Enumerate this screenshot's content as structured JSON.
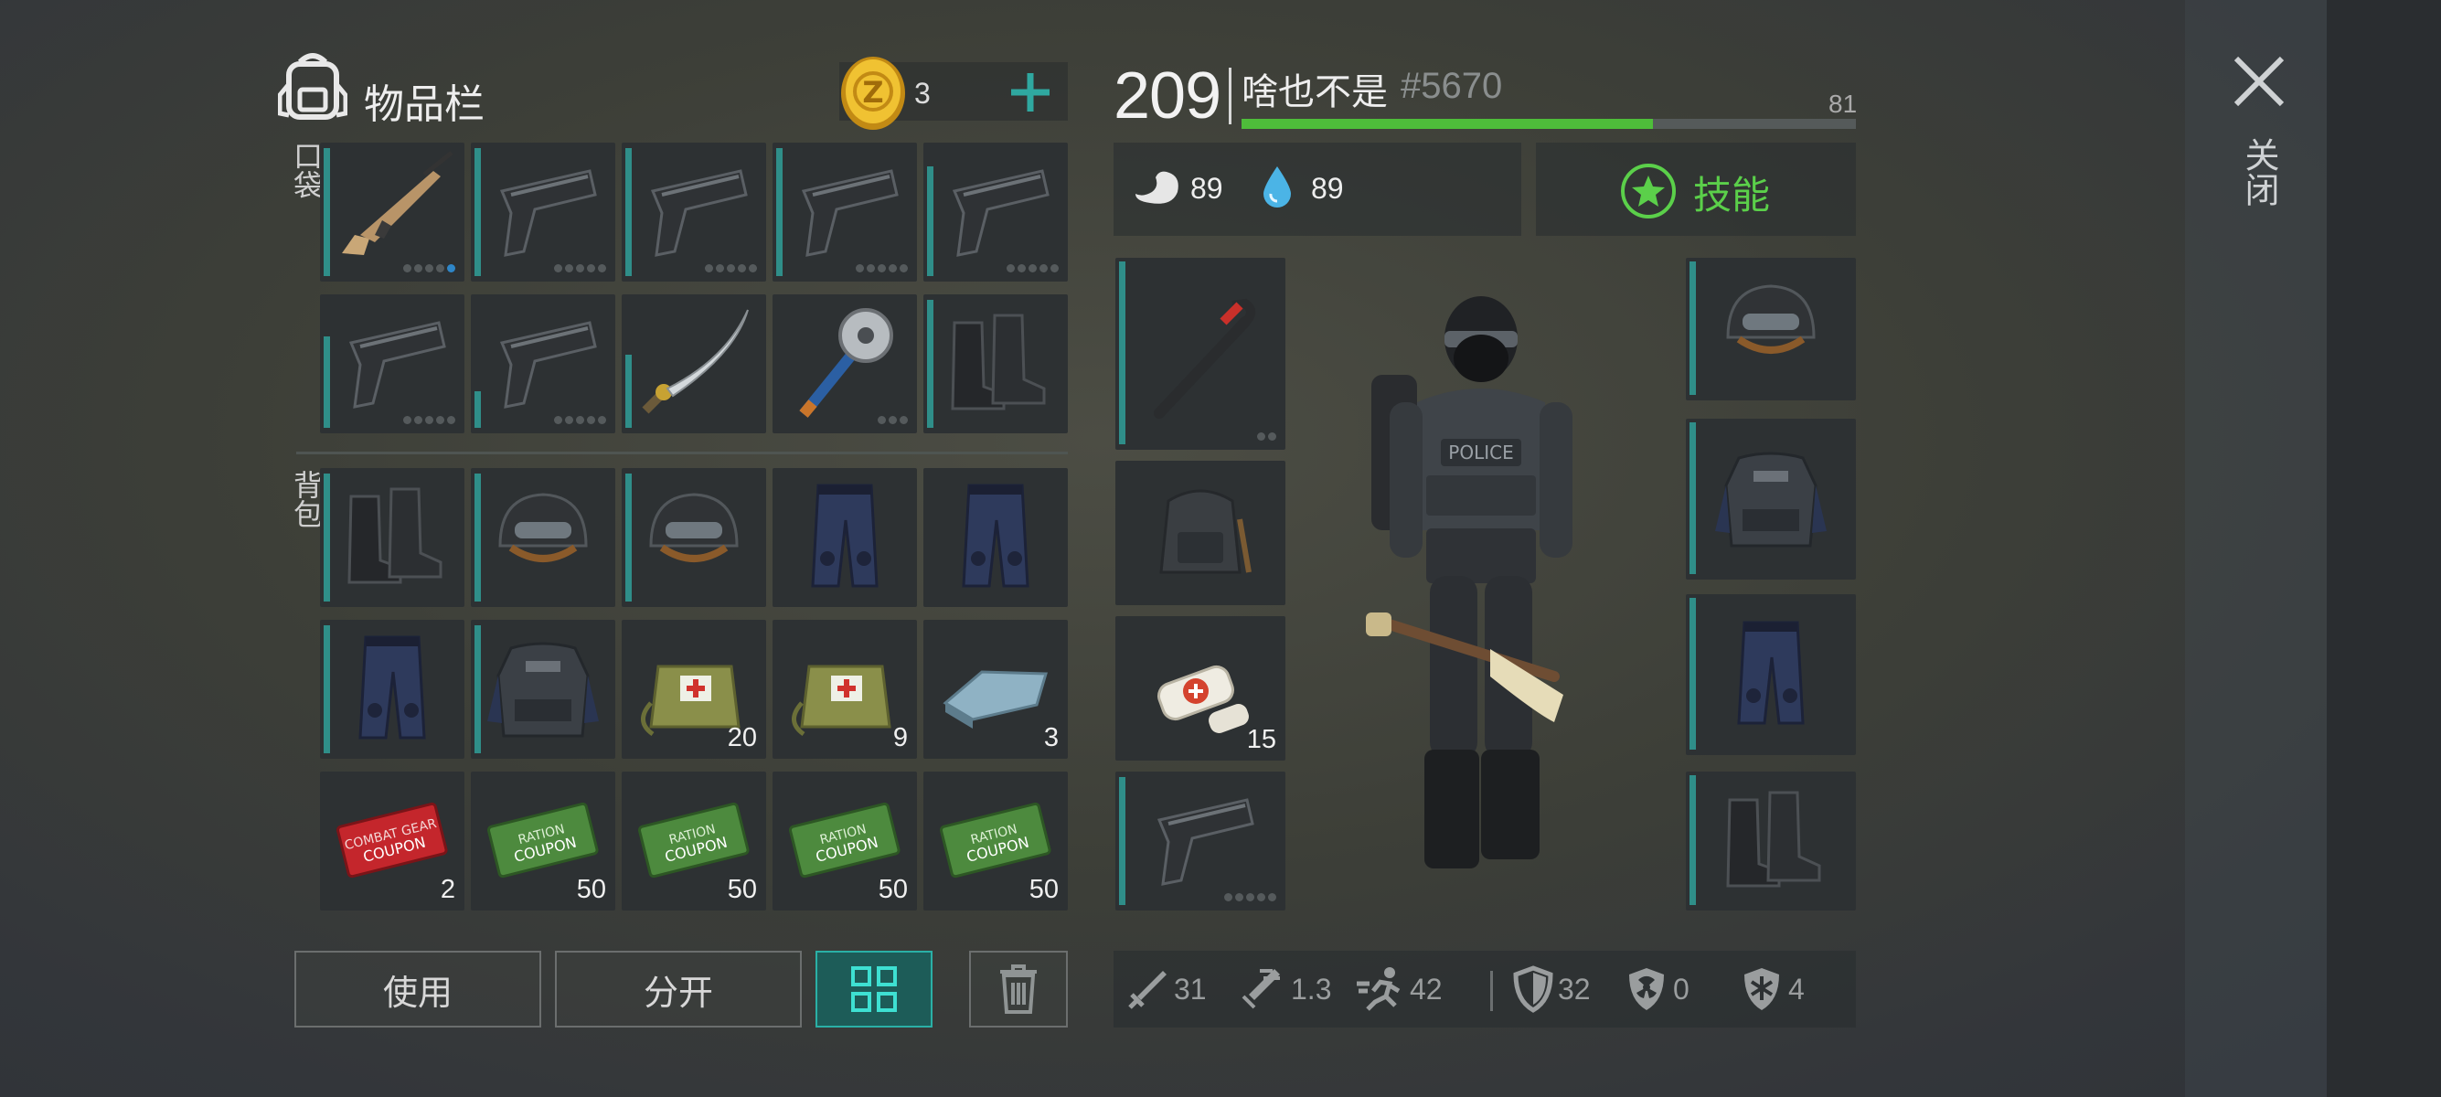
{
  "inventory": {
    "title": "物品栏",
    "coins": "3",
    "pocket_label": "口袋",
    "backpack_label": "背包",
    "pocket_items": [
      {
        "icon": "assault-rifle-icon"
      },
      {
        "icon": "pistol-icon"
      },
      {
        "icon": "pistol-icon"
      },
      {
        "icon": "pistol-icon"
      },
      {
        "icon": "pistol-icon"
      },
      {
        "icon": "pistol-icon"
      },
      {
        "icon": "pistol-icon"
      },
      {
        "icon": "katana-icon"
      },
      {
        "icon": "sawblade-mace-icon"
      },
      {
        "icon": "boots-icon"
      }
    ],
    "backpack_items": [
      {
        "icon": "boots-icon",
        "count": ""
      },
      {
        "icon": "helmet-icon",
        "count": ""
      },
      {
        "icon": "helmet-icon",
        "count": ""
      },
      {
        "icon": "pants-icon",
        "count": ""
      },
      {
        "icon": "pants-icon",
        "count": ""
      },
      {
        "icon": "pants-icon",
        "count": ""
      },
      {
        "icon": "vest-icon",
        "count": ""
      },
      {
        "icon": "medkit-bag-icon",
        "count": "20"
      },
      {
        "icon": "medkit-bag-icon",
        "count": "9"
      },
      {
        "icon": "metal-ingot-icon",
        "count": "3"
      },
      {
        "icon": "combat-gear-coupon-icon",
        "count": "2"
      },
      {
        "icon": "ration-coupon-icon",
        "count": "50"
      },
      {
        "icon": "ration-coupon-icon",
        "count": "50"
      },
      {
        "icon": "ration-coupon-icon",
        "count": "50"
      },
      {
        "icon": "ration-coupon-icon",
        "count": "50"
      }
    ],
    "buttons": {
      "use": "使用",
      "split": "分开"
    }
  },
  "player": {
    "level": "209",
    "name": "啥也不是",
    "tag": "#5670",
    "xp_value": "81",
    "xp_fraction": 0.67,
    "hunger": "89",
    "thirst": "89",
    "skills_label": "技能",
    "left_equipment": [
      {
        "icon": "crowbar-icon",
        "count": ""
      },
      {
        "icon": "backpack-icon",
        "count": ""
      },
      {
        "icon": "bandage-icon",
        "count": "15"
      },
      {
        "icon": "pistol-icon",
        "count": ""
      }
    ],
    "right_equipment": [
      {
        "icon": "helmet-icon"
      },
      {
        "icon": "vest-icon"
      },
      {
        "icon": "pants-icon"
      },
      {
        "icon": "boots-icon"
      }
    ],
    "stats": {
      "damage": "31",
      "attack_speed": "1.3",
      "move_speed": "42",
      "armor": "32",
      "radiation": "0",
      "cold": "4"
    }
  },
  "close_label": "关闭",
  "colors": {
    "accent": "#2f8e89",
    "xp_green": "#4ebd3a",
    "skill_green": "#5bd04a"
  }
}
